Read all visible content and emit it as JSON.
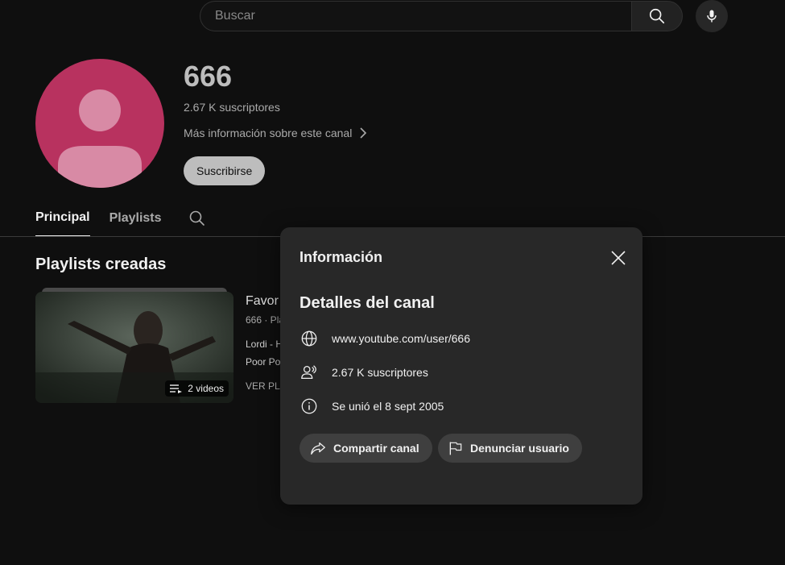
{
  "search": {
    "placeholder": "Buscar"
  },
  "channel": {
    "name": "666",
    "subscribers": "2.67 K suscriptores",
    "more_info": "Más información sobre este canal",
    "subscribe_label": "Suscribirse",
    "avatar_color": "#b8325f"
  },
  "tabs": [
    {
      "label": "Principal",
      "active": true
    },
    {
      "label": "Playlists",
      "active": false
    }
  ],
  "section": {
    "title": "Playlists creadas"
  },
  "playlist": {
    "title": "Favor",
    "meta": "666 · Pla",
    "line1": "Lordi - H",
    "line2": "Poor Po",
    "view_label": "VER PLA",
    "video_count": "2 videos"
  },
  "modal": {
    "title": "Información",
    "details_title": "Detalles del canal",
    "url": "www.youtube.com/user/666",
    "subscribers": "2.67 K suscriptores",
    "joined": "Se unió el 8 sept 2005",
    "share_label": "Compartir canal",
    "report_label": "Denunciar usuario"
  },
  "icons": {
    "search": "search-icon",
    "mic": "microphone-icon",
    "chevron": "chevron-right-icon",
    "close": "close-icon",
    "globe": "globe-icon",
    "subscribers": "people-icon",
    "info": "info-icon",
    "share": "share-icon",
    "flag": "flag-icon",
    "playlist": "playlist-icon"
  }
}
